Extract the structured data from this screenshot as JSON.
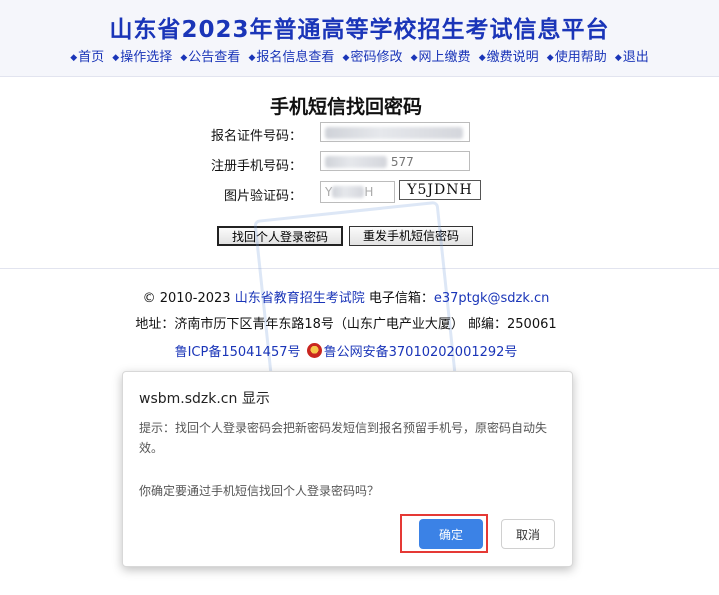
{
  "header": {
    "title": "山东省2023年普通高等学校招生考试信息平台",
    "nav": [
      "首页",
      "操作选择",
      "公告查看",
      "报名信息查看",
      "密码修改",
      "网上缴费",
      "缴费说明",
      "使用帮助",
      "退出"
    ]
  },
  "form": {
    "title": "手机短信找回密码",
    "id_label": "报名证件号码：",
    "phone_label": "注册手机号码：",
    "phone_value_visible": "577",
    "captcha_label": "图片验证码：",
    "captcha_input_placeholder": "Y",
    "captcha_input_tail": "H",
    "captcha_image_text": "Y5JDNH",
    "retrieve_button": "找回个人登录密码",
    "resend_button": "重发手机短信密码"
  },
  "footer": {
    "copyright_prefix": "© 2010-2023 ",
    "org_link": "山东省教育招生考试院",
    "email_label": " 电子信箱：",
    "email": "e37ptgk@sdzk.cn",
    "address": "地址：济南市历下区青年东路18号（山东广电产业大厦） 邮编：250061",
    "icp": "鲁ICP备15041457号",
    "police": "鲁公网安备37010202001292号"
  },
  "dialog": {
    "origin": "wsbm.sdzk.cn 显示",
    "message1": "提示：找回个人登录密码会把新密码发短信到报名预留手机号，原密码自动失效。",
    "message2": "你确定要通过手机短信找回个人登录密码吗？",
    "ok": "确定",
    "cancel": "取消"
  },
  "colors": {
    "brand_blue": "#1a35b8",
    "ok_button": "#3b82e6",
    "highlight_red": "#e53935"
  }
}
